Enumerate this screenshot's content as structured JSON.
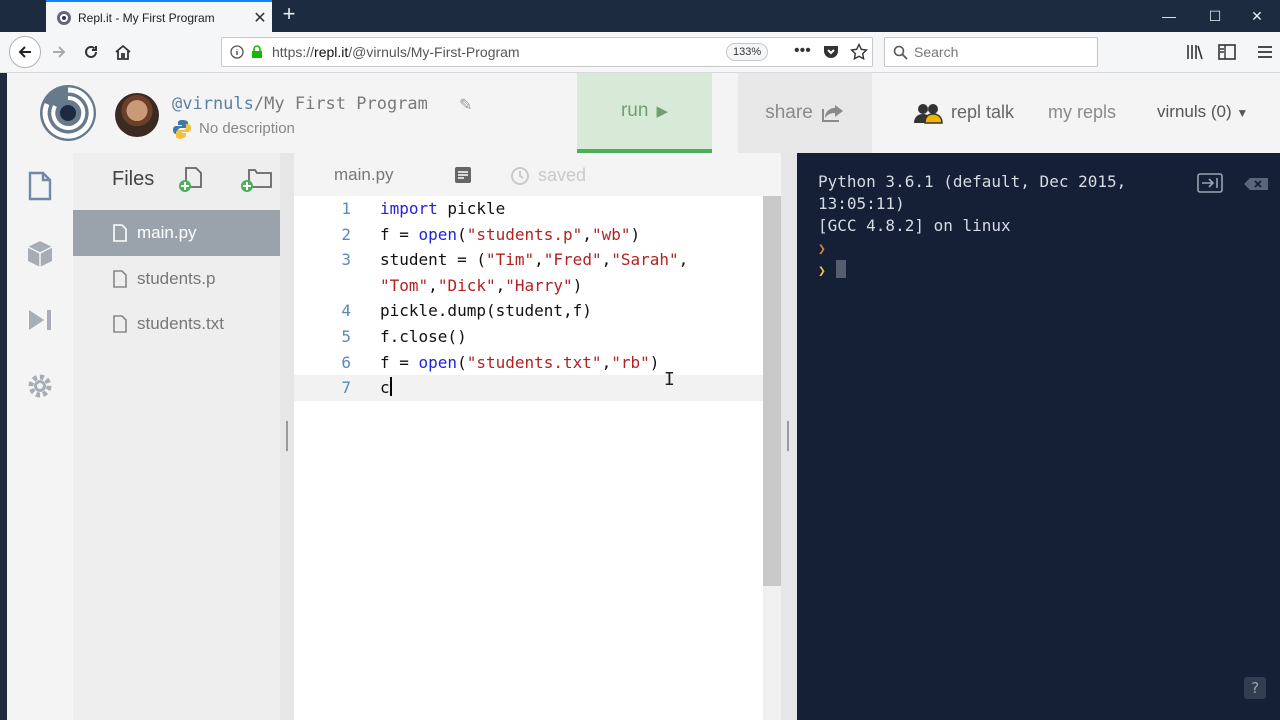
{
  "browser": {
    "tab_title": "Repl.it - My First Program",
    "url_prefix": "https://",
    "url_host": "repl.it",
    "url_path": "/@virnuls/My-First-Program",
    "zoom": "133%",
    "search_placeholder": "Search"
  },
  "header": {
    "owner": "@virnuls",
    "separator": "/",
    "project_name": "My First Program",
    "description": "No description",
    "run_label": "run",
    "share_label": "share",
    "repl_talk_label": "repl talk",
    "my_repls_label": "my repls",
    "user_label": "virnuls (0)"
  },
  "files": {
    "title": "Files",
    "items": [
      {
        "name": "main.py"
      },
      {
        "name": "students.p"
      },
      {
        "name": "students.txt"
      }
    ]
  },
  "editor": {
    "tab_label": "main.py",
    "status": "saved",
    "line_numbers": [
      "1",
      "2",
      "3",
      "4",
      "5",
      "6",
      "7"
    ],
    "lines": [
      "import pickle",
      "f = open(\"students.p\",\"wb\")",
      "student = (\"Tim\",\"Fred\",\"Sarah\",",
      "\"Tom\",\"Dick\",\"Harry\")",
      "pickle.dump(student,f)",
      "f.close()",
      "f = open(\"students.txt\",\"rb\")",
      "c"
    ]
  },
  "console": {
    "lines": [
      "Python 3.6.1 (default, Dec 2015,",
      "13:05:11)",
      "[GCC 4.8.2] on linux"
    ],
    "help_label": "?"
  },
  "colors": {
    "accent_run": "#4fae5a",
    "console_bg": "#151f35",
    "active_file_bg": "#9aa3ac"
  }
}
